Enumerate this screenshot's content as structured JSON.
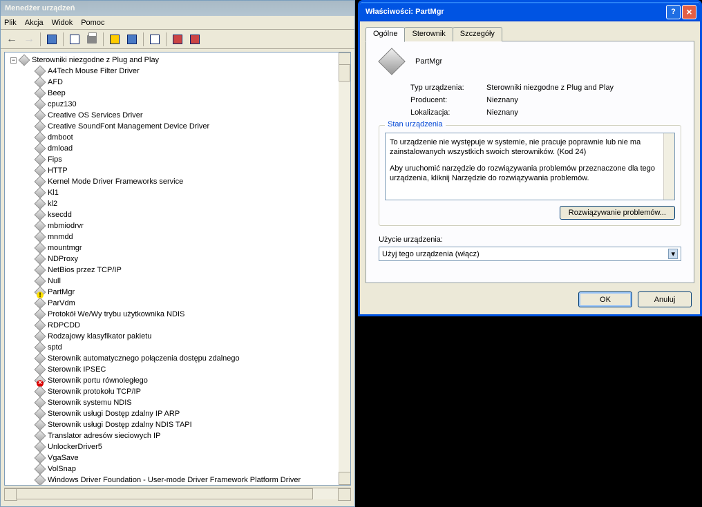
{
  "dm": {
    "title": "Menedżer urządzeń",
    "menu": {
      "file": "Plik",
      "action": "Akcja",
      "view": "Widok",
      "help": "Pomoc"
    },
    "root": "Sterowniki niezgodne z Plug and Play",
    "items": [
      {
        "label": "A4Tech Mouse Filter Driver",
        "state": ""
      },
      {
        "label": "AFD",
        "state": ""
      },
      {
        "label": "Beep",
        "state": ""
      },
      {
        "label": "cpuz130",
        "state": ""
      },
      {
        "label": "Creative OS Services Driver",
        "state": ""
      },
      {
        "label": "Creative SoundFont Management Device Driver",
        "state": ""
      },
      {
        "label": "dmboot",
        "state": ""
      },
      {
        "label": "dmload",
        "state": ""
      },
      {
        "label": "Fips",
        "state": ""
      },
      {
        "label": "HTTP",
        "state": ""
      },
      {
        "label": "Kernel Mode Driver Frameworks service",
        "state": ""
      },
      {
        "label": "Kl1",
        "state": ""
      },
      {
        "label": "kl2",
        "state": ""
      },
      {
        "label": "ksecdd",
        "state": ""
      },
      {
        "label": "mbmiodrvr",
        "state": ""
      },
      {
        "label": "mnmdd",
        "state": ""
      },
      {
        "label": "mountmgr",
        "state": ""
      },
      {
        "label": "NDProxy",
        "state": ""
      },
      {
        "label": "NetBios przez TCP/IP",
        "state": ""
      },
      {
        "label": "Null",
        "state": ""
      },
      {
        "label": "PartMgr",
        "state": "warn"
      },
      {
        "label": "ParVdm",
        "state": ""
      },
      {
        "label": "Protokół We/Wy trybu użytkownika NDIS",
        "state": ""
      },
      {
        "label": "RDPCDD",
        "state": ""
      },
      {
        "label": "Rodzajowy klasyfikator pakietu",
        "state": ""
      },
      {
        "label": "sptd",
        "state": ""
      },
      {
        "label": "Sterownik automatycznego połączenia dostępu zdalnego",
        "state": ""
      },
      {
        "label": "Sterownik IPSEC",
        "state": ""
      },
      {
        "label": "Sterownik portu równoległego",
        "state": "err"
      },
      {
        "label": "Sterownik protokołu TCP/IP",
        "state": ""
      },
      {
        "label": "Sterownik systemu NDIS",
        "state": ""
      },
      {
        "label": "Sterownik usługi Dostęp zdalny IP ARP",
        "state": ""
      },
      {
        "label": "Sterownik usługi Dostęp zdalny NDIS TAPI",
        "state": ""
      },
      {
        "label": "Translator adresów sieciowych IP",
        "state": ""
      },
      {
        "label": "UnlockerDriver5",
        "state": ""
      },
      {
        "label": "VgaSave",
        "state": ""
      },
      {
        "label": "VolSnap",
        "state": ""
      },
      {
        "label": "Windows Driver Foundation - User-mode Driver Framework Platform Driver",
        "state": ""
      }
    ]
  },
  "prop": {
    "title": "Właściwości: PartMgr",
    "tabs": {
      "general": "Ogólne",
      "driver": "Sterownik",
      "details": "Szczegóły"
    },
    "name": "PartMgr",
    "type_label": "Typ urządzenia:",
    "type_value": "Sterowniki niezgodne z Plug and Play",
    "mfr_label": "Producent:",
    "mfr_value": "Nieznany",
    "loc_label": "Lokalizacja:",
    "loc_value": "Nieznany",
    "status_group": "Stan urządzenia",
    "status_text1": "To urządzenie nie występuje w systemie, nie pracuje poprawnie lub nie ma zainstalowanych wszystkich swoich sterowników. (Kod 24)",
    "status_text2": "Aby uruchomić narzędzie do rozwiązywania problemów przeznaczone dla tego urządzenia, kliknij Narzędzie do rozwiązywania problemów.",
    "trouble_btn": "Rozwiązywanie problemów...",
    "usage_label": "Użycie urządzenia:",
    "usage_value": "Użyj tego urządzenia (włącz)",
    "ok": "OK",
    "cancel": "Anuluj"
  }
}
